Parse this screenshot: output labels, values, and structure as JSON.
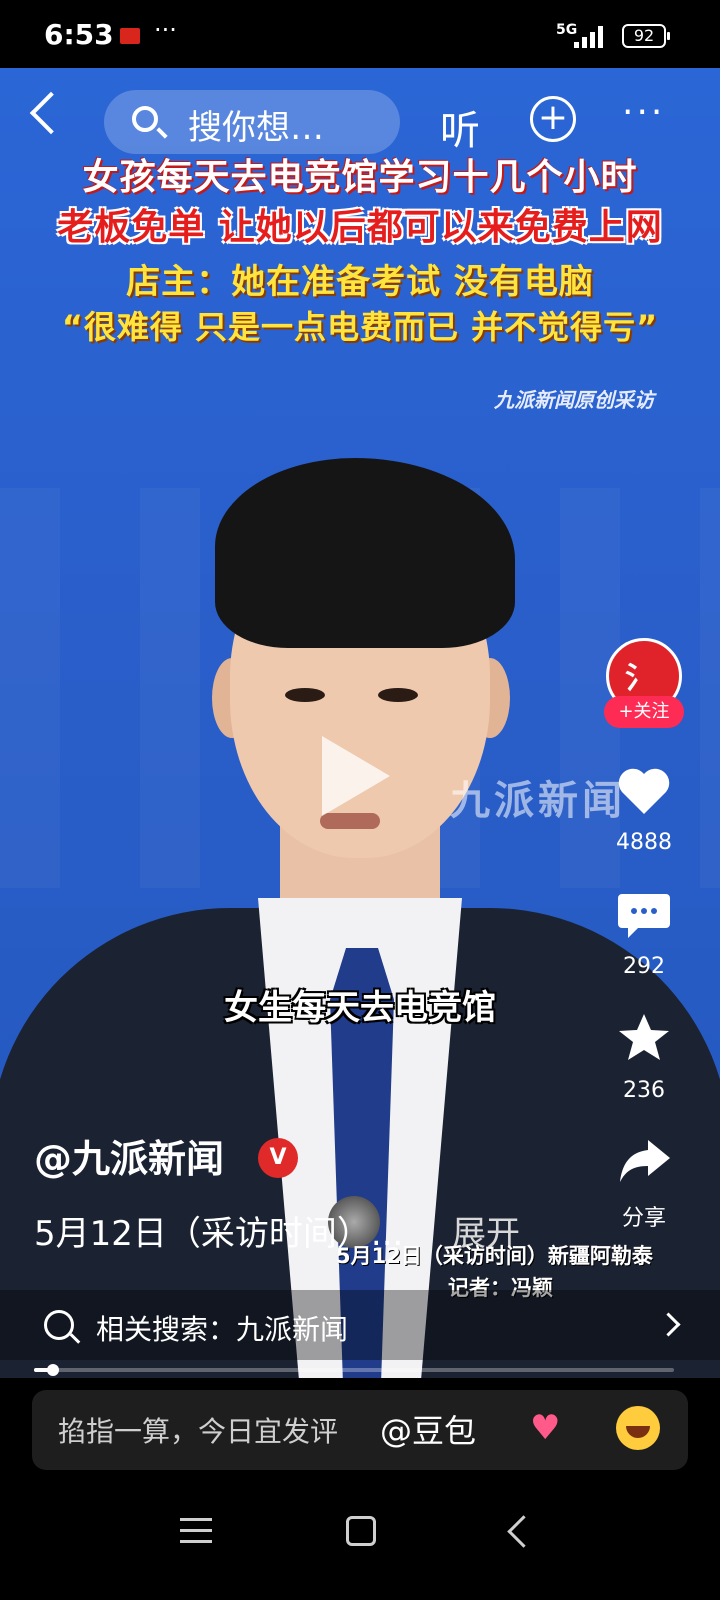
{
  "status": {
    "time": "6:53",
    "dots": "···",
    "network": "5G",
    "battery": "92"
  },
  "topbar": {
    "search_placeholder": "搜你想…",
    "listen_label": "听"
  },
  "video": {
    "headline_1": "女孩每天去电竞馆学习十几个小时",
    "headline_2": "老板免单 让她以后都可以来免费上网",
    "headline_3": "店主：她在准备考试 没有电脑",
    "headline_4": "“很难得 只是一点电费而已 并不觉得亏”",
    "credit": "九派新闻原创采访",
    "watermark": "九派新闻",
    "subtitle": "女生每天去电竞馆",
    "burn_in_line_1": "5月12日（采访时间）新疆阿勒泰",
    "burn_in_line_2": "记者：冯颖",
    "progress": 0.03
  },
  "actions": {
    "follow_label": "+关注",
    "likes": "4888",
    "comments": "292",
    "favorites": "236",
    "share_label": "分享"
  },
  "post": {
    "author": "@九派新闻",
    "verified": "V",
    "description": "5月12日（采访时间）...",
    "expand_label": "展开"
  },
  "related": {
    "label": "相关搜索：九派新闻"
  },
  "comment_bar": {
    "placeholder": "掐指一算，今日宜发评",
    "mention": "@豆包"
  },
  "colors": {
    "accent": "#fe2c55",
    "verified": "#e02a2a"
  }
}
